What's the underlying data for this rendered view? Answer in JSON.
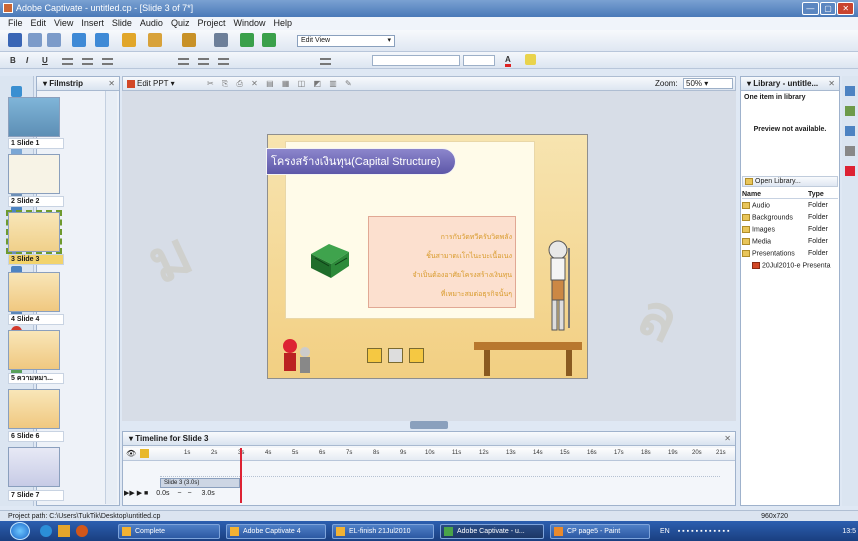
{
  "window": {
    "title": "Adobe Captivate - untitled.cp - [Slide 3 of 7*]",
    "controls": [
      "—",
      "▢",
      "✕"
    ]
  },
  "menu": [
    "File",
    "Edit",
    "View",
    "Insert",
    "Slide",
    "Audio",
    "Quiz",
    "Project",
    "Window",
    "Help"
  ],
  "toolbar": {
    "edit_view": "Edit View"
  },
  "formatbar": {
    "bold": "B",
    "italic": "I",
    "underline": "U",
    "font_color": "A"
  },
  "filmstrip": {
    "title": "Filmstrip",
    "slides": [
      {
        "label": "1 Slide 1"
      },
      {
        "label": "2 Slide 2"
      },
      {
        "label": "3 Slide 3"
      },
      {
        "label": "4 Slide 4"
      },
      {
        "label": "5 ความหมา..."
      },
      {
        "label": "6 Slide 6"
      },
      {
        "label": "7 Slide 7"
      }
    ]
  },
  "editbar": {
    "edit_ppt": "Edit PPT",
    "zoom_label": "Zoom:",
    "zoom_value": "50%"
  },
  "slide": {
    "title": "โครงสร้างเงินทุน(Capital Structure)",
    "lines": [
      "การกับวัดทวีครับวิดพลัง",
      "ชิ้นสามาดเเโกไนะบะเนื้อเนง",
      "จำเป็นต้องอาศัยโครงสร้างเงินทุน",
      "ที่เหมาะสมต่อธุรกิจนั้นๆ"
    ]
  },
  "timeline": {
    "title": "Timeline for Slide 3",
    "ticks": [
      "1s",
      "2s",
      "3s",
      "4s",
      "5s",
      "6s",
      "7s",
      "8s",
      "9s",
      "10s",
      "11s",
      "12s",
      "13s",
      "14s",
      "15s",
      "16s",
      "17s",
      "18s",
      "19s",
      "20s",
      "21s"
    ],
    "slide_bar": "Slide 3 (3.0s)",
    "start": "0.0s",
    "end": "3.0s"
  },
  "library": {
    "title": "Library - untitle...",
    "summary": "One item in library",
    "preview": "Preview not available.",
    "open_btn": "Open Library...",
    "col_name": "Name",
    "col_type": "Type",
    "items": [
      {
        "name": "Audio",
        "type": "Folder"
      },
      {
        "name": "Backgrounds",
        "type": "Folder"
      },
      {
        "name": "Images",
        "type": "Folder"
      },
      {
        "name": "Media",
        "type": "Folder"
      },
      {
        "name": "Presentations",
        "type": "Folder"
      },
      {
        "name": "20Jul2010-e Presenta",
        "type": ""
      }
    ]
  },
  "status": {
    "path": "Project path: C:\\Users\\TukTik\\Desktop\\untitled.cp",
    "resolution": "960x720"
  },
  "taskbar": {
    "tasks": [
      "Complete",
      "Adobe Captivate 4",
      "EL-finish 21Jul2010",
      "Adobe Captivate - u...",
      "CP page5 - Paint"
    ],
    "lang": "EN",
    "clock": "13:5"
  }
}
